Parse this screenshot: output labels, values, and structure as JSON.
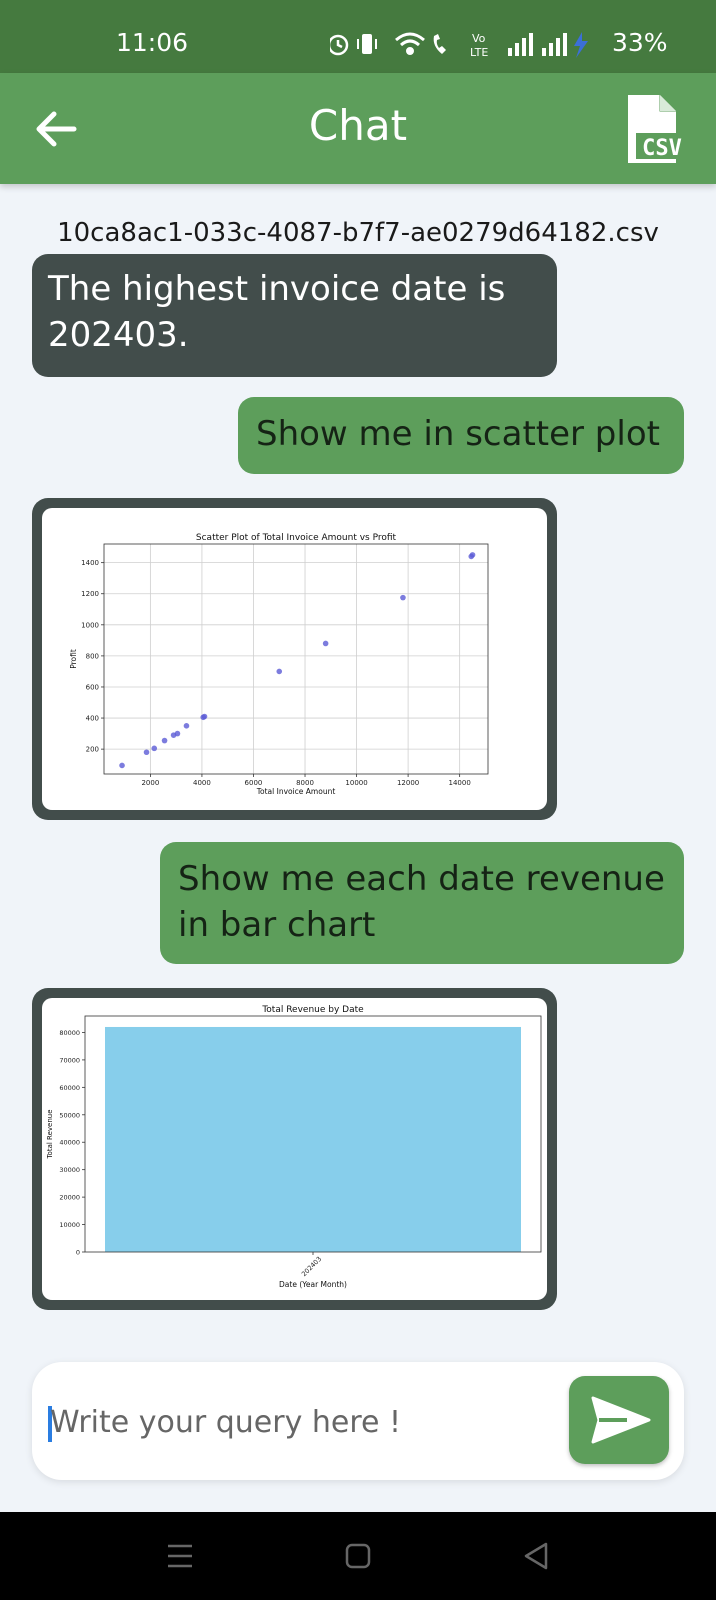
{
  "status": {
    "time": "11:06",
    "battery": "33%"
  },
  "header": {
    "title": "Chat",
    "csv_label": "CSV"
  },
  "file": {
    "name": "10ca8ac1-033c-4087-b7f7-ae0279d64182.csv"
  },
  "messages": {
    "bot_1_line1": "The highest invoice date is",
    "bot_1_line2": "202403.",
    "user_1": "Show me in scatter plot",
    "user_2_line1": "Show me each date revenue",
    "user_2_line2": "in bar chart"
  },
  "chart_data": [
    {
      "type": "scatter",
      "title": "Scatter Plot of Total Invoice Amount vs Profit",
      "xlabel": "Total Invoice Amount",
      "ylabel": "Profit",
      "xlim": [
        200,
        15100
      ],
      "ylim": [
        40,
        1520
      ],
      "xticks": [
        2000,
        4000,
        6000,
        8000,
        10000,
        12000,
        14000
      ],
      "yticks": [
        200,
        400,
        600,
        800,
        1000,
        1200,
        1400
      ],
      "grid": true,
      "color": "#5b5bd6",
      "x": [
        900,
        1850,
        2150,
        2550,
        2900,
        3050,
        3400,
        4050,
        4100,
        7000,
        8800,
        11800,
        14450,
        14500
      ],
      "y": [
        95,
        180,
        205,
        255,
        290,
        300,
        350,
        405,
        410,
        700,
        880,
        1175,
        1440,
        1450
      ]
    },
    {
      "type": "bar",
      "title": "Total Revenue by Date",
      "xlabel": "Date (Year Month)",
      "ylabel": "Total Revenue",
      "ylim": [
        0,
        86000
      ],
      "yticks": [
        0,
        10000,
        20000,
        30000,
        40000,
        50000,
        60000,
        70000,
        80000
      ],
      "color": "#87ceeb",
      "categories": [
        "202403"
      ],
      "values": [
        82000
      ]
    }
  ],
  "composer": {
    "placeholder": "Write your query here !"
  },
  "icons": {
    "back": "arrow-left-icon",
    "csv": "csv-file-icon",
    "send": "send-icon",
    "nav_menu": "menu-icon",
    "nav_home": "home-icon",
    "nav_back": "back-triangle-icon"
  }
}
